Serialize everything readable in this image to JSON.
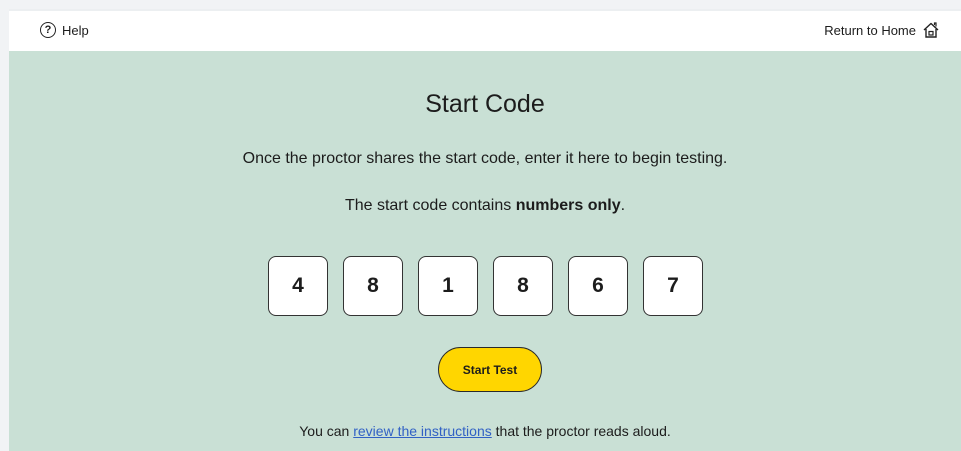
{
  "header": {
    "help_label": "Help",
    "help_icon": "question-circle-icon",
    "home_label": "Return to Home",
    "home_icon": "home-icon"
  },
  "main": {
    "title": "Start Code",
    "instruction": "Once the proctor shares the start code, enter it here to begin testing.",
    "note_prefix": "The start code contains ",
    "note_bold": "numbers only",
    "note_suffix": ".",
    "code_digits": [
      "4",
      "8",
      "1",
      "8",
      "6",
      "7"
    ],
    "start_button_label": "Start Test",
    "footer_prefix": "You can ",
    "footer_link": "review the instructions",
    "footer_suffix": " that the proctor reads aloud."
  },
  "colors": {
    "page_background": "#c9e0d5",
    "button_yellow": "#ffd600",
    "link_blue": "#3161c5"
  }
}
